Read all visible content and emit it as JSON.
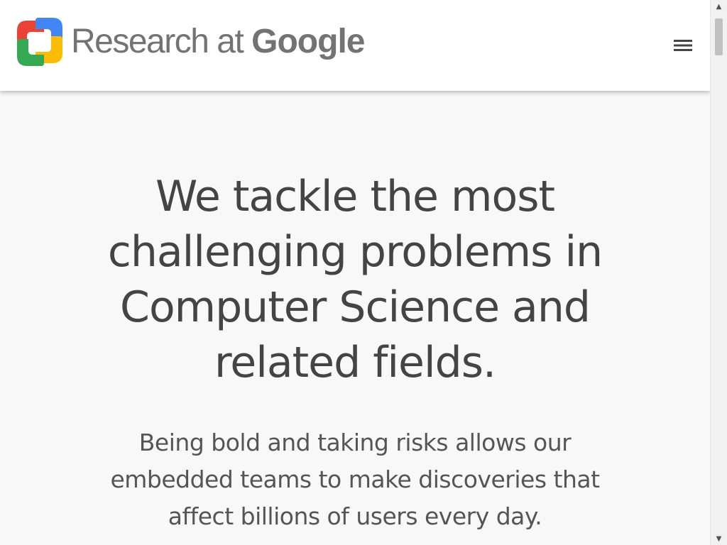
{
  "header": {
    "brand_prefix": "Research at ",
    "brand_google": "Google",
    "logo_icon": "google-research-logo-icon",
    "menu_icon": "hamburger-menu-icon",
    "logo_colors": [
      "#ea4335",
      "#4285f4",
      "#fbbc05",
      "#34a853"
    ]
  },
  "hero": {
    "headline": "We tackle the most challenging problems in Computer Science and related fields.",
    "subtext": "Being bold and taking risks allows our embedded teams to make discoveries that affect billions of users every day."
  },
  "scrollbar": {
    "up_arrow": "▲",
    "down_arrow": "▼"
  },
  "colors": {
    "header_bg": "#ffffff",
    "page_bg": "#f8f8f8",
    "text_primary": "#444444",
    "text_brand": "#737373"
  }
}
